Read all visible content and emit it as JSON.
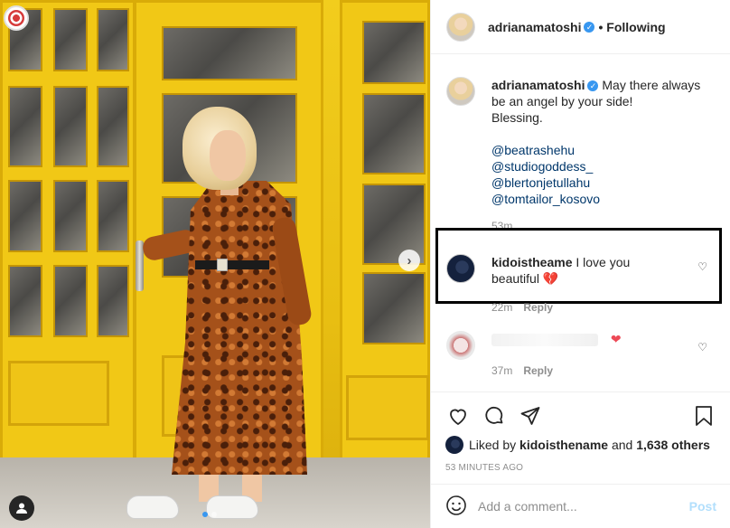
{
  "post": {
    "username": "adrianamatoshi",
    "following": "• Following",
    "verified_icon": "verified-badge-icon",
    "caption": {
      "text": "May there always be an angel by your side!",
      "line2": "Blessing.",
      "mentions": [
        "@beatrashehu",
        "@studiogoddess_",
        "@blertonjetullahu",
        "@tomtailor_kosovo"
      ],
      "time": "53m"
    },
    "comments": [
      {
        "username": "kidoistheame",
        "text": "I love you beautiful",
        "emoji": "💔",
        "time": "22m",
        "reply": "Reply"
      },
      {
        "username": "",
        "text": "",
        "emoji": "❤",
        "time": "37m",
        "reply": "Reply"
      }
    ],
    "likes": {
      "prefix": "Liked by",
      "user": "kidoisthename",
      "joiner": "and",
      "count": "1,638 others"
    },
    "ago": "53 MINUTES AGO",
    "add_comment": {
      "placeholder": "Add a comment...",
      "post_label": "Post"
    }
  },
  "colors": {
    "link": "#00376b",
    "verified": "#3897f0",
    "muted": "#8e8e8e",
    "post_disabled": "#b2dffc"
  }
}
